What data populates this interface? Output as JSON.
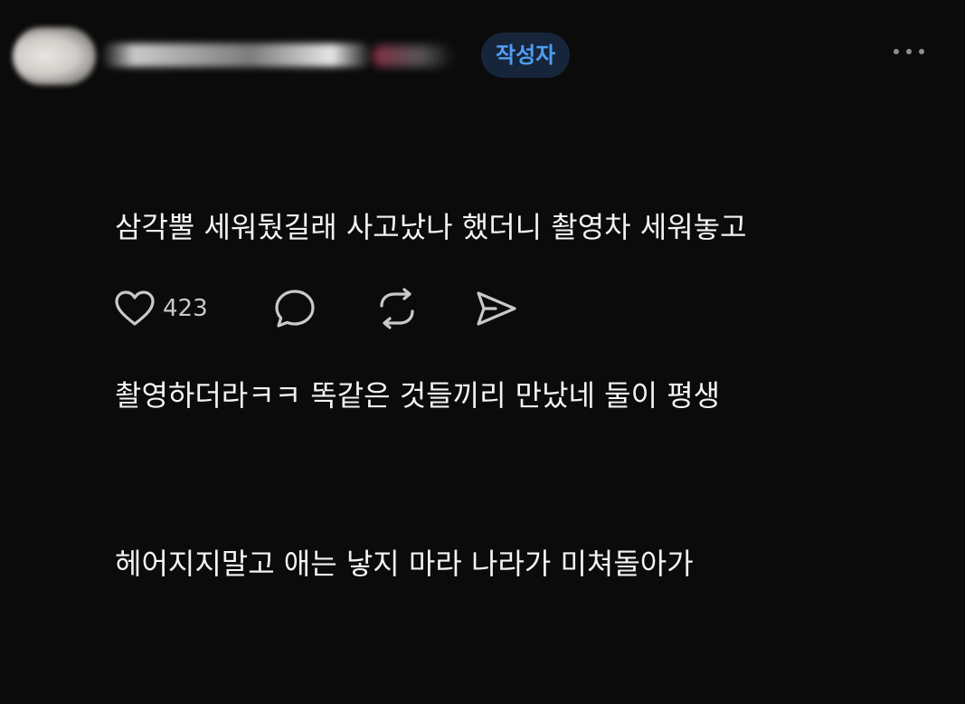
{
  "header": {
    "author_badge": "작성자"
  },
  "post": {
    "lines": [
      "삼각뿔 세워뒀길래 사고났나 했더니 촬영차 세워놓고",
      "촬영하더라ㅋㅋ 똑같은 것들끼리 만났네 둘이 평생",
      "헤어지지말고 애는 낳지 마라 나라가 미쳐돌아가"
    ]
  },
  "actions": {
    "like_count": "423",
    "icons": [
      "heart-icon",
      "comment-icon",
      "repost-icon",
      "share-icon"
    ]
  },
  "colors": {
    "background": "#0b0b0b",
    "badge_bg": "#16253a",
    "badge_text": "#4e9cf2",
    "icon": "#c9c9c9"
  }
}
